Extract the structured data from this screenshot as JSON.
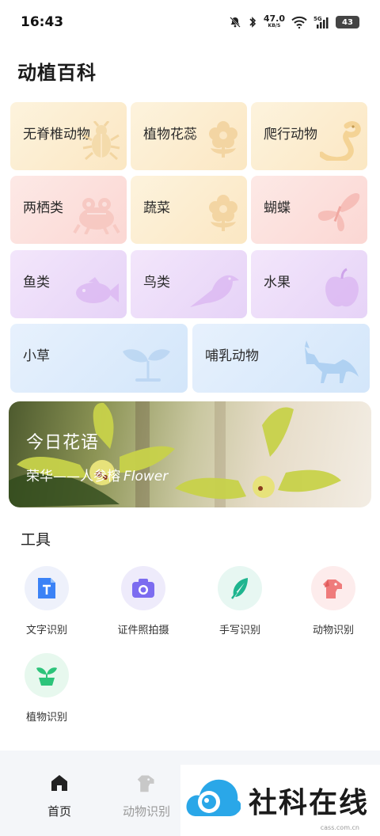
{
  "status_bar": {
    "time": "16:43",
    "net_speed": "47.0",
    "net_unit": "KB/S",
    "signal_label": "5G",
    "battery": "43"
  },
  "app_title": "动植百科",
  "categories": [
    {
      "label": "无脊椎动物",
      "icon": "insect-icon",
      "color": "yellow"
    },
    {
      "label": "植物花蕊",
      "icon": "flower-icon",
      "color": "yellow"
    },
    {
      "label": "爬行动物",
      "icon": "snake-icon",
      "color": "yellow"
    },
    {
      "label": "两栖类",
      "icon": "frog-icon",
      "color": "pink"
    },
    {
      "label": "蔬菜",
      "icon": "flower-icon",
      "color": "yellow"
    },
    {
      "label": "蝴蝶",
      "icon": "butterfly-icon",
      "color": "pink"
    },
    {
      "label": "鱼类",
      "icon": "fish-icon",
      "color": "purple"
    },
    {
      "label": "鸟类",
      "icon": "bird-icon",
      "color": "purple"
    },
    {
      "label": "水果",
      "icon": "apple-icon",
      "color": "purple"
    },
    {
      "label": "小草",
      "icon": "sprout-icon",
      "color": "blue"
    },
    {
      "label": "哺乳动物",
      "icon": "fox-icon",
      "color": "blue"
    }
  ],
  "banner": {
    "title": "今日花语",
    "subtitle": "荣华——人参榕",
    "subtitle_en": "Flower"
  },
  "tools_title": "工具",
  "tools": [
    {
      "label": "文字识别",
      "icon": "text-recognition-icon",
      "accent": "#3b82f6"
    },
    {
      "label": "证件照拍摄",
      "icon": "camera-icon",
      "accent": "#7c6cf0"
    },
    {
      "label": "手写识别",
      "icon": "feather-icon",
      "accent": "#1fb58f"
    },
    {
      "label": "动物识别",
      "icon": "dog-icon",
      "accent": "#ef7b7b"
    },
    {
      "label": "植物识别",
      "icon": "potted-plant-icon",
      "accent": "#2cc47a"
    }
  ],
  "bottom_nav": {
    "items": [
      {
        "label": "首页",
        "icon": "home-icon",
        "active": true
      },
      {
        "label": "动物识别",
        "icon": "dog-icon",
        "active": false
      }
    ]
  },
  "watermark": {
    "text": "社科在线",
    "url": "cass.com.cn"
  }
}
